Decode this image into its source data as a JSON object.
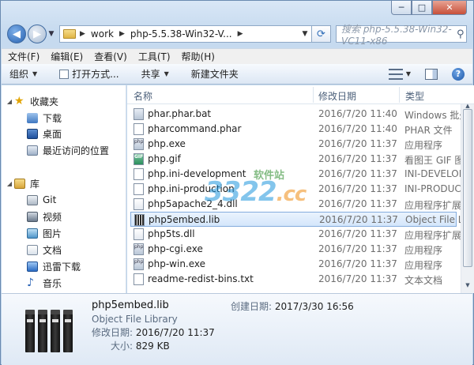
{
  "window": {
    "caption_min": "─",
    "caption_max": "□",
    "caption_close": "✕"
  },
  "address": {
    "crumbs": [
      "work",
      "php-5.5.38-Win32-V..."
    ],
    "dropdown": "▼"
  },
  "search": {
    "placeholder": "搜索 php-5.5.38-Win32-VC11-x86"
  },
  "menu": [
    "文件(F)",
    "编辑(E)",
    "查看(V)",
    "工具(T)",
    "帮助(H)"
  ],
  "toolbar": {
    "organize": "组织",
    "open_with": "打开方式...",
    "share": "共享",
    "new_folder": "新建文件夹",
    "help": "?"
  },
  "nav_pane": {
    "favorites": "收藏夹",
    "downloads": "下载",
    "desktop": "桌面",
    "recent": "最近访问的位置",
    "libraries": "库",
    "git": "Git",
    "videos": "视频",
    "pictures": "图片",
    "documents": "文档",
    "thunder": "迅雷下载",
    "music": "音乐"
  },
  "columns": {
    "name": "名称",
    "modified": "修改日期",
    "type": "类型"
  },
  "files": [
    {
      "name": "phar.phar.bat",
      "date": "2016/7/20 11:40",
      "type": "Windows 批处",
      "icon": "bat-icon"
    },
    {
      "name": "pharcommand.phar",
      "date": "2016/7/20 11:40",
      "type": "PHAR 文件",
      "icon": "file-icon"
    },
    {
      "name": "php.exe",
      "date": "2016/7/20 11:37",
      "type": "应用程序",
      "icon": "exe-icon"
    },
    {
      "name": "php.gif",
      "date": "2016/7/20 11:37",
      "type": "看图王 GIF 图",
      "icon": "gif-icon"
    },
    {
      "name": "php.ini-development",
      "date": "2016/7/20 11:37",
      "type": "INI-DEVELOP",
      "icon": "file-icon"
    },
    {
      "name": "php.ini-production",
      "date": "2016/7/20 11:37",
      "type": "INI-PRODUC",
      "icon": "file-icon"
    },
    {
      "name": "php5apache2_4.dll",
      "date": "2016/7/20 11:37",
      "type": "应用程序扩展",
      "icon": "dll-icon"
    },
    {
      "name": "php5embed.lib",
      "date": "2016/7/20 11:37",
      "type": "Object File L",
      "icon": "lib-icon",
      "selected": true
    },
    {
      "name": "php5ts.dll",
      "date": "2016/7/20 11:37",
      "type": "应用程序扩展",
      "icon": "dll-icon"
    },
    {
      "name": "php-cgi.exe",
      "date": "2016/7/20 11:37",
      "type": "应用程序",
      "icon": "exe-icon"
    },
    {
      "name": "php-win.exe",
      "date": "2016/7/20 11:37",
      "type": "应用程序",
      "icon": "exe-icon"
    },
    {
      "name": "readme-redist-bins.txt",
      "date": "2016/7/20 11:37",
      "type": "文本文档",
      "icon": "txt-icon"
    }
  ],
  "details": {
    "name": "php5embed.lib",
    "type": "Object File Library",
    "modified_label": "修改日期:",
    "modified_value": "2016/7/20 11:37",
    "size_label": "大小:",
    "size_value": "829 KB",
    "created_label": "创建日期:",
    "created_value": "2017/3/30 16:56"
  },
  "watermark": {
    "digits": "3322",
    "tld": ".cc",
    "site": "软件站"
  }
}
